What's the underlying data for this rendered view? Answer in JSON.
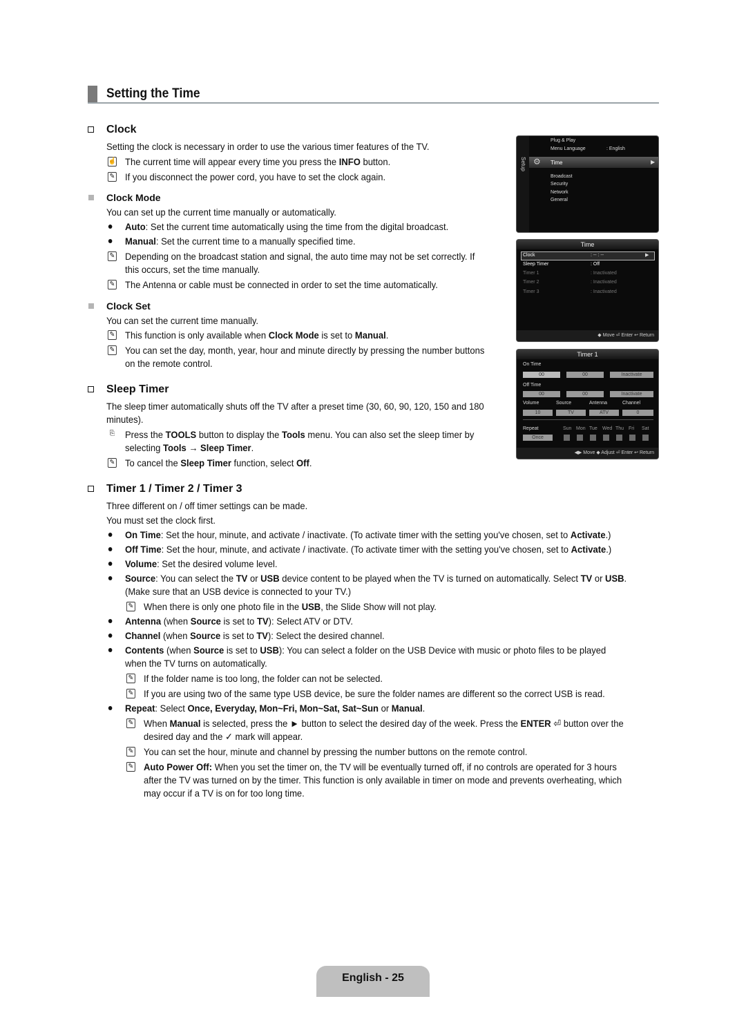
{
  "page": {
    "section_title": "Setting the Time",
    "footer": "English - 25"
  },
  "clock": {
    "heading": "Clock",
    "intro": "Setting the clock is necessary in order to use the various timer features of the TV.",
    "notes": [
      {
        "pre": "The current time will appear every time you press the ",
        "b": "INFO",
        "post": " button."
      },
      {
        "text": "If you disconnect the power cord, you have to set the clock again."
      }
    ],
    "clock_mode": {
      "heading": "Clock Mode",
      "intro": "You can set up the current time manually or automatically.",
      "bullets": [
        {
          "b": "Auto",
          "text": ": Set the current time automatically using the time from the digital broadcast."
        },
        {
          "b": "Manual",
          "text": ": Set the current time to a manually specified time."
        }
      ],
      "notes": [
        "Depending on the broadcast station and signal, the auto time may not be set correctly. If",
        "this occurs, set the time manually.",
        "The Antenna or cable must be connected in order to set the time automatically."
      ]
    },
    "clock_set": {
      "heading": "Clock Set",
      "intro": "You can set the current time manually.",
      "note1": {
        "pre": "This function is only available when ",
        "b1": "Clock Mode",
        "mid": " is set to ",
        "b2": "Manual",
        "post": "."
      },
      "note2_l1": "You can set the day, month, year, hour and minute directly by pressing the number buttons",
      "note2_l2": "on the remote control."
    }
  },
  "sleep_timer": {
    "heading": "Sleep Timer",
    "intro_l1": "The sleep timer automatically shuts off the TV after a preset time (30, 60, 90, 120, 150 and 180",
    "intro_l2": "minutes).",
    "tools_l1": {
      "pre": "Press the ",
      "b1": "TOOLS",
      "mid": " button to display the ",
      "b2": "Tools",
      "post": " menu. You can also set the sleep timer by"
    },
    "tools_l2": {
      "pre": "selecting ",
      "b1": "Tools",
      "arrow": " → ",
      "b2": "Sleep Timer",
      "post": "."
    },
    "cancel": {
      "pre": "To cancel the ",
      "b1": "Sleep Timer",
      "mid": " function, select ",
      "b2": "Off",
      "post": "."
    }
  },
  "timers": {
    "heading": "Timer 1 / Timer 2 / Timer 3",
    "intro1": "Three different on / off timer settings can be made.",
    "intro2": "You must set the clock first.",
    "on_time": {
      "b": "On Time",
      "text": ": Set the hour, minute, and activate / inactivate. (To activate timer with the setting you've chosen, set to ",
      "b2": "Activate",
      "post": ".)"
    },
    "off_time": {
      "b": "Off Time",
      "text": ": Set the hour, minute, and activate / inactivate. (To activate timer with the setting you've chosen, set to ",
      "b2": "Activate",
      "post": ".)"
    },
    "volume": {
      "b": "Volume",
      "text": ": Set the desired volume level."
    },
    "source_l1": {
      "b": "Source",
      "a": ": You can select the ",
      "b2": "TV",
      "c": " or ",
      "b3": "USB",
      "d": " device content to be played when the TV is turned on automatically. Select ",
      "b4": "TV",
      "e": " or ",
      "b5": "USB",
      "f": "."
    },
    "source_l2": "(Make sure that an USB device is connected to your TV.)",
    "usb_note": {
      "pre": "When there is only one photo file in the ",
      "b": "USB",
      "post": ", the Slide Show will not play."
    },
    "antenna": {
      "b": "Antenna",
      "a": " (when ",
      "b2": "Source",
      "c": " is set to ",
      "b3": "TV",
      "d": "): Select ATV or DTV."
    },
    "channel": {
      "b": "Channel",
      "a": " (when ",
      "b2": "Source",
      "c": " is set to ",
      "b3": "TV",
      "d": "): Select the desired channel."
    },
    "contents_l1": {
      "b": "Contents",
      "a": " (when ",
      "b2": "Source",
      "c": " is set to ",
      "b3": "USB",
      "d": "): You can select a folder on the USB Device with music or photo files to be played"
    },
    "contents_l2": "when the TV turns on automatically.",
    "folder_note1": "If the folder name is too long, the folder can not be selected.",
    "folder_note2": "If you are using two of the same type USB device, be sure the folder names are different so the correct USB is read.",
    "repeat": {
      "b": "Repeat",
      "a": ": Select ",
      "b2": "Once, Everyday, Mon~Fri, Mon~Sat, Sat~Sun",
      "c": " or ",
      "b3": "Manual",
      "d": "."
    },
    "manual_note_l1": {
      "pre": "When ",
      "b": "Manual",
      "mid": " is selected, press the ► button to select the desired day of the week. Press the ",
      "b2": "ENTER",
      "post": " button over the"
    },
    "manual_note_l2": "desired day and the ✓ mark will appear.",
    "number_note": "You can set the hour, minute and channel by pressing the number buttons on the remote control.",
    "auto_off": {
      "b": "Auto Power Off:",
      "l1": " When you set the timer on, the TV will be eventually turned off, if no controls are operated for 3 hours",
      "l2": "after the TV was turned on by the timer. This function is only available in timer on mode and prevents overheating, which",
      "l3": "may occur if a TV is on for too long time."
    }
  },
  "screen_setup": {
    "side_label": "Setup",
    "items": [
      "Plug & Play",
      "Menu Language",
      "Time",
      "Broadcast",
      "Security",
      "Network",
      "General"
    ],
    "menu_language_value": ": English"
  },
  "screen_time": {
    "title": "Time",
    "rows": [
      {
        "label": "Clock",
        "value": ": -- : --"
      },
      {
        "label": "Sleep Timer",
        "value": ": Off"
      },
      {
        "label": "Timer 1",
        "value": ": Inactivated"
      },
      {
        "label": "Timer 2",
        "value": ": Inactivated"
      },
      {
        "label": "Timer 3",
        "value": ": Inactivated"
      }
    ],
    "footer": "◆ Move   ⏎ Enter   ↩ Return"
  },
  "screen_timer1": {
    "title": "Timer 1",
    "on_time_label": "On Time",
    "off_time_label": "Off Time",
    "on_hour": "00",
    "on_min": "00",
    "on_state": "Inactivate",
    "off_hour": "00",
    "off_min": "00",
    "off_state": "Inactivate",
    "volume_label": "Volume",
    "source_label": "Source",
    "antenna_label": "Antenna",
    "channel_label": "Channel",
    "volume": "10",
    "source": "TV",
    "antenna": "ATV",
    "channel": "0",
    "repeat_label": "Repeat",
    "repeat": "Once",
    "days": [
      "Sun",
      "Mon",
      "Tue",
      "Wed",
      "Thu",
      "Fri",
      "Sat"
    ],
    "footer": "◀▶ Move   ◆ Adjust   ⏎ Enter   ↩ Return"
  }
}
